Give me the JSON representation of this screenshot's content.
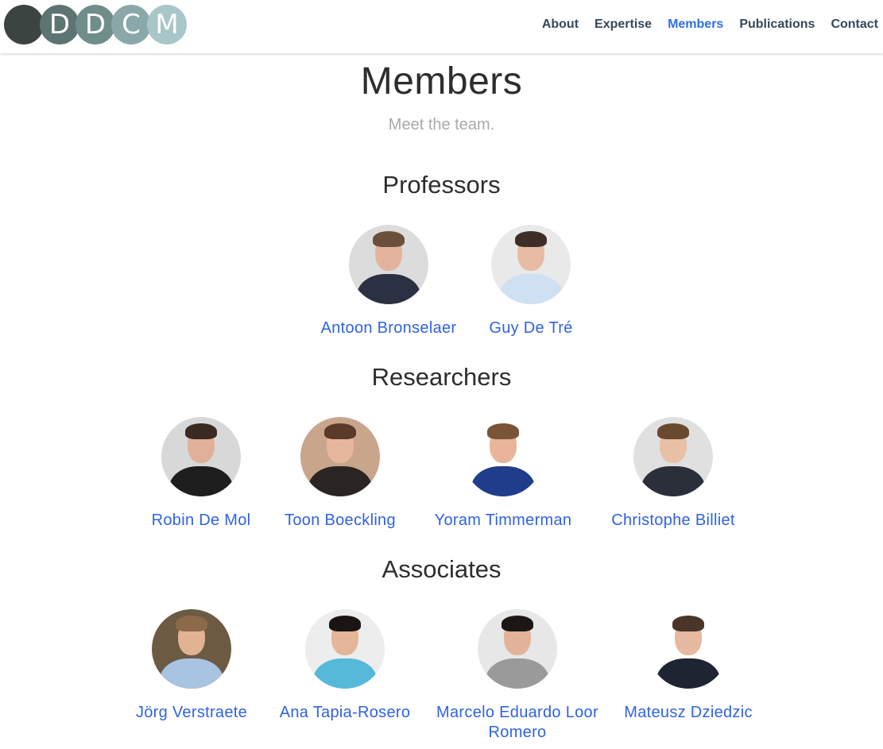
{
  "header": {
    "logo_letters": [
      "",
      "D",
      "D",
      "C",
      "M"
    ],
    "logo_colors": [
      "#3c4442",
      "#5c7472",
      "#6f8d8b",
      "#8aa8a9",
      "#a9c6c8"
    ],
    "nav": [
      {
        "label": "About",
        "active": false
      },
      {
        "label": "Expertise",
        "active": false
      },
      {
        "label": "Members",
        "active": true
      },
      {
        "label": "Publications",
        "active": false
      },
      {
        "label": "Contact",
        "active": false
      }
    ],
    "accent_color": "#2f6fe0"
  },
  "main": {
    "title": "Members",
    "subtitle": "Meet the team.",
    "sections": [
      {
        "title": "Professors",
        "members": [
          {
            "name": "Antoon Bronselaer"
          },
          {
            "name": "Guy De Tré"
          }
        ]
      },
      {
        "title": "Researchers",
        "members": [
          {
            "name": "Robin De Mol"
          },
          {
            "name": "Toon Boeckling"
          },
          {
            "name": "Yoram Timmerman"
          },
          {
            "name": "Christophe Billiet"
          }
        ]
      },
      {
        "title": "Associates",
        "members": [
          {
            "name": "Jörg Verstraete"
          },
          {
            "name": "Ana Tapia-Rosero"
          },
          {
            "name": "Marcelo Eduardo Loor Romero"
          },
          {
            "name": "Mateusz Dziedzic"
          }
        ]
      }
    ]
  }
}
